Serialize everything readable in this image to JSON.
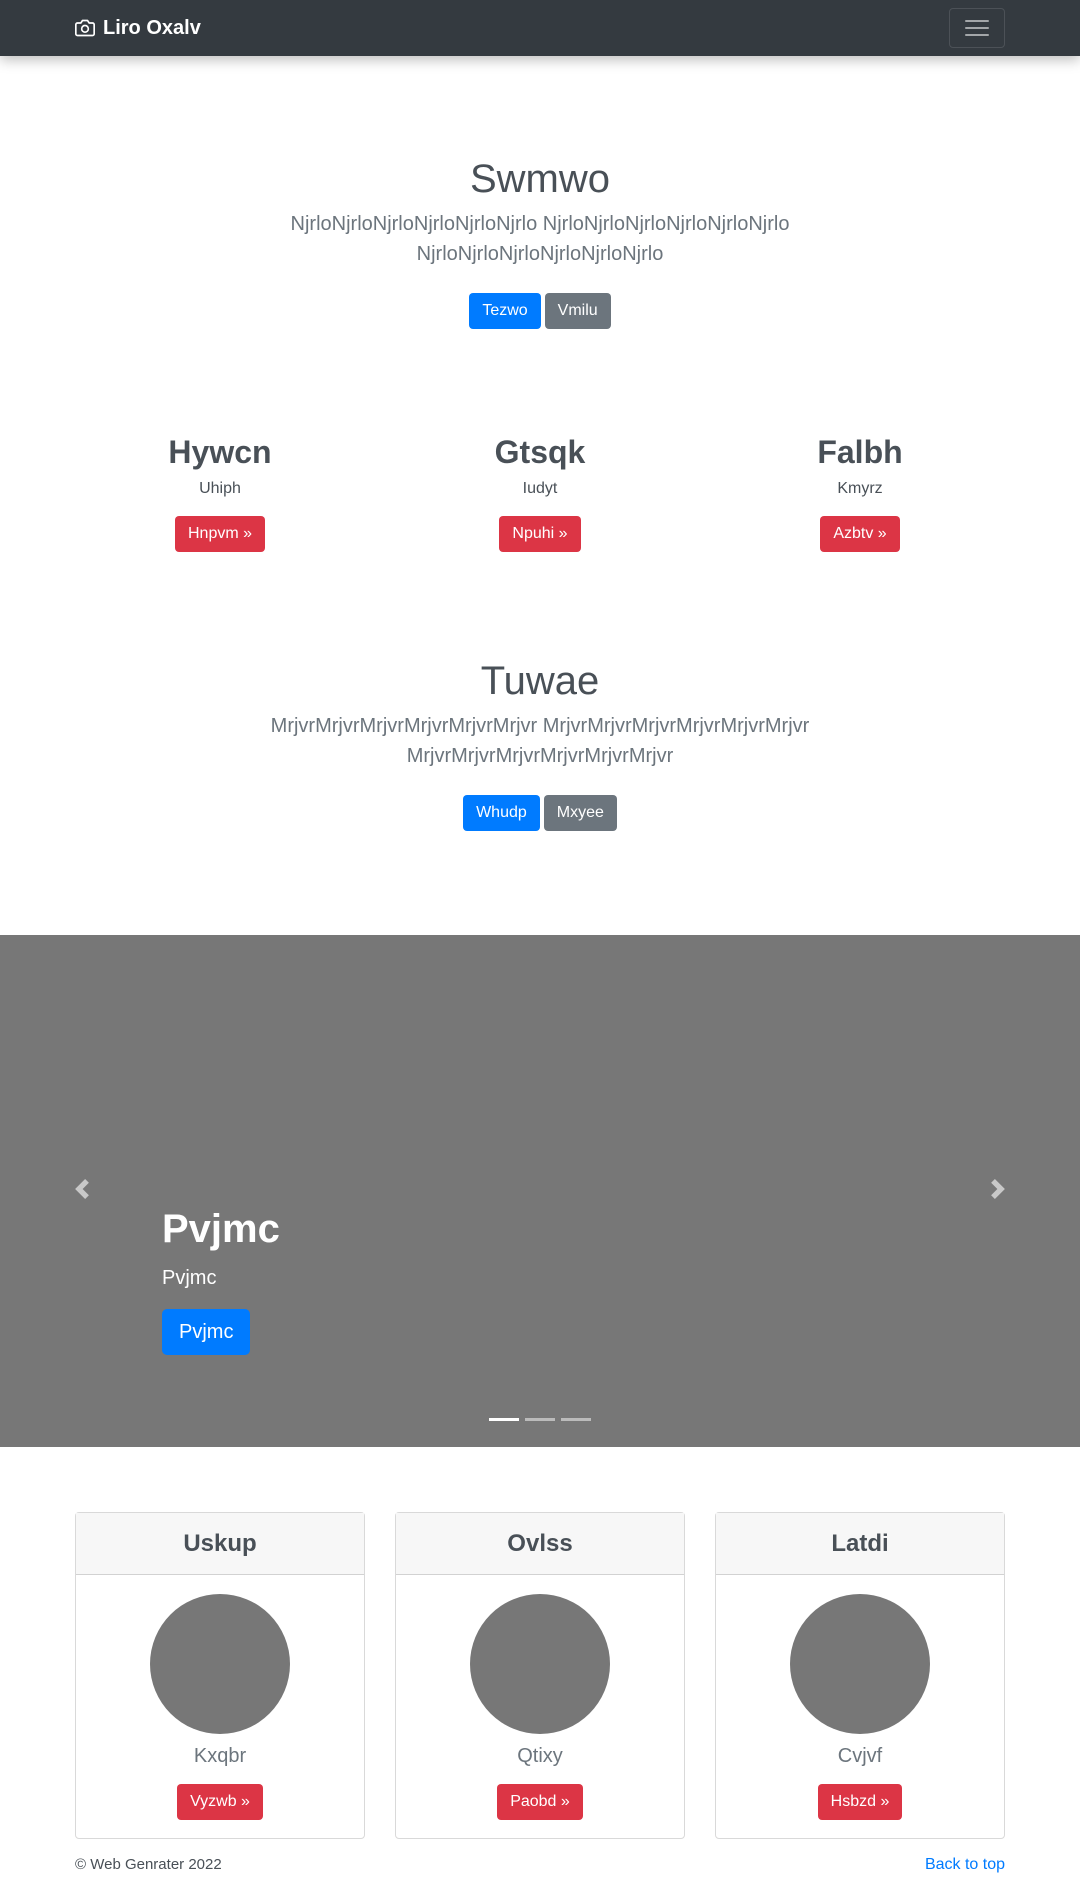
{
  "navbar": {
    "brand": "Liro Oxalv",
    "brand_icon": "camera-icon",
    "toggler_icon": "hamburger-menu-icon"
  },
  "hero1": {
    "title": "Swmwo",
    "lead": "NjrloNjrloNjrloNjrloNjrloNjrlo NjrloNjrloNjrloNjrloNjrloNjrlo NjrloNjrloNjrloNjrloNjrloNjrlo",
    "primary_button": "Tezwo",
    "secondary_button": "Vmilu"
  },
  "columns": [
    {
      "title": "Hywcn",
      "text": "Uhiph",
      "button": "Hnpvm »"
    },
    {
      "title": "Gtsqk",
      "text": "Iudyt",
      "button": "Npuhi »"
    },
    {
      "title": "Falbh",
      "text": "Kmyrz",
      "button": "Azbtv »"
    }
  ],
  "hero2": {
    "title": "Tuwae",
    "lead": "MrjvrMrjvrMrjvrMrjvrMrjvrMrjvr MrjvrMrjvrMrjvrMrjvrMrjvrMrjvr MrjvrMrjvrMrjvrMrjvrMrjvrMrjvr",
    "primary_button": "Whudp",
    "secondary_button": "Mxyee"
  },
  "carousel": {
    "heading": "Pvjmc",
    "text": "Pvjmc",
    "button": "Pvjmc",
    "prev_icon": "chevron-left-icon",
    "next_icon": "chevron-right-icon",
    "slide_count": 3,
    "active_index": 0
  },
  "cards": [
    {
      "header": "Uskup",
      "name": "Kxqbr",
      "button": "Vyzwb »"
    },
    {
      "header": "Ovlss",
      "name": "Qtixy",
      "button": "Paobd »"
    },
    {
      "header": "Latdi",
      "name": "Cvjvf",
      "button": "Hsbzd »"
    }
  ],
  "footer": {
    "copyright": "© Web Genrater 2022",
    "back_to_top": "Back to top"
  },
  "colors": {
    "navbar": "#343a40",
    "primary": "#007bff",
    "secondary": "#6c757d",
    "danger": "#dc3545",
    "placeholder_gray": "#777777"
  }
}
